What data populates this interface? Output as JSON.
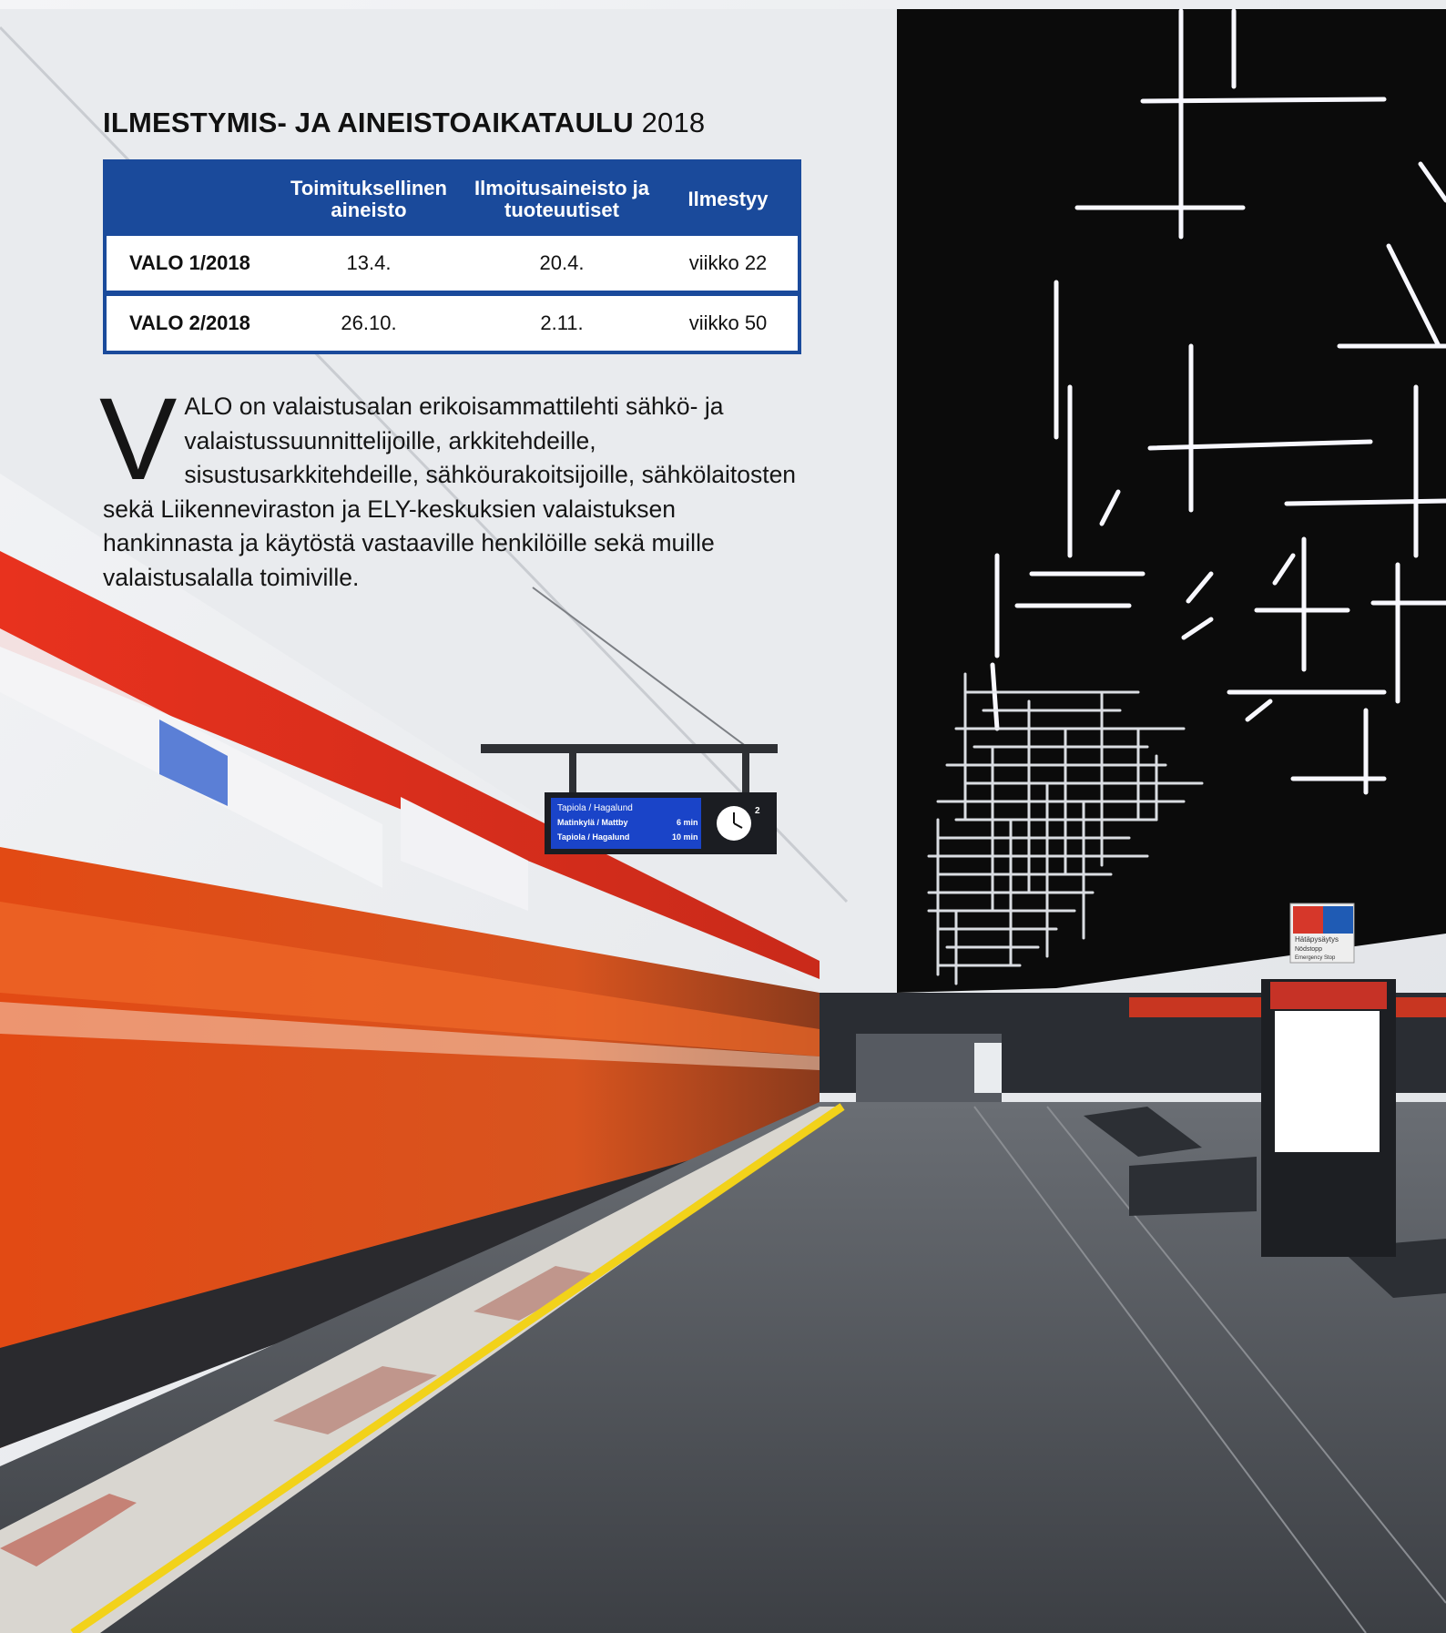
{
  "schedule": {
    "title_bold": "ILMESTYMIS- JA AINEISTOAIKATAULU",
    "title_year": "2018",
    "headers": {
      "col1": "Toimituksellinen aineisto",
      "col2": "Ilmoitusaineisto ja tuoteuutiset",
      "col3": "Ilmestyy"
    },
    "rows": [
      {
        "issue": "VALO 1/2018",
        "editorial": "13.4.",
        "ads": "20.4.",
        "published": "viikko 22"
      },
      {
        "issue": "VALO 2/2018",
        "editorial": "26.10.",
        "ads": "2.11.",
        "published": "viikko 50"
      }
    ],
    "colors": {
      "header_bg": "#1a4a9b"
    }
  },
  "intro": {
    "dropcap": "V",
    "text": "ALO on valaistusalan erikoisammattilehti sähkö- ja valaistussuunnittelijoille, arkkitehdeille, sisustusarkkitehdeille, sähköurakoitsijoille, sähkölaitosten sekä Liikenneviraston ja ELY-keskuksien valaistuksen hankinnasta ja käytöstä vastaaville henkilöille sekä muille valaistusalalla toimiville."
  },
  "photo": {
    "display_board": {
      "rows": [
        {
          "destination": "Tapiola / Hagalund",
          "time": ""
        },
        {
          "destination": "Matinkylä / Mattby",
          "time": "6 min"
        },
        {
          "destination": "Tapiola / Hagalund",
          "time": "10 min"
        }
      ],
      "platform": "2"
    },
    "emergency_sign": {
      "line1": "Hätäpysäytys",
      "line2": "Nödstopp",
      "line3": "Emergency Stop"
    },
    "colors": {
      "train": "#e8541c",
      "ceiling": "#0b0b0b",
      "floor": "#4a4d52",
      "safety_line": "#f2d21a"
    }
  }
}
